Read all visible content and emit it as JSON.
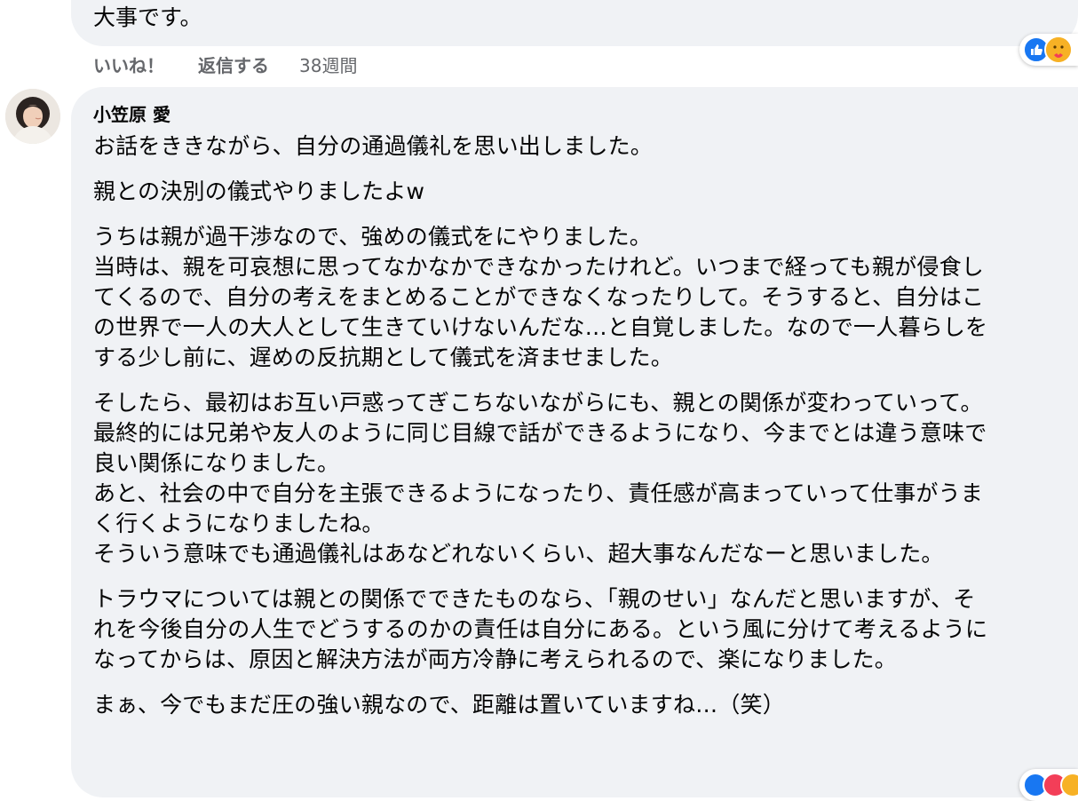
{
  "previous_comment": {
    "text_tail": "大事です。",
    "actions": {
      "like": "いいね！",
      "reply": "返信する",
      "time": "38週間"
    },
    "reactions": [
      "like-icon",
      "care-icon"
    ]
  },
  "comment": {
    "author": "小笠原 愛",
    "avatar": "profile-photo",
    "paragraphs": [
      [
        "お話をききながら、自分の通過儀礼を思い出しました。"
      ],
      [
        "親との決別の儀式やりましたよw"
      ],
      [
        "うちは親が過干渉なので、強めの儀式をにやりました。",
        "当時は、親を可哀想に思ってなかなかできなかったけれど。いつまで経っても親が侵食し",
        "てくるので、自分の考えをまとめることができなくなったりして。そうすると、自分はこ",
        "の世界で一人の大人として生きていけないんだな…と自覚しました。なので一人暮らしを",
        "する少し前に、遅めの反抗期として儀式を済ませました。"
      ],
      [
        "そしたら、最初はお互い戸惑ってぎこちないながらにも、親との関係が変わっていって。",
        "最終的には兄弟や友人のように同じ目線で話ができるようになり、今までとは違う意味で",
        "良い関係になりました。",
        "あと、社会の中で自分を主張できるようになったり、責任感が高まっていって仕事がうま",
        "く行くようになりましたね。",
        "そういう意味でも通過儀礼はあなどれないくらい、超大事なんだなーと思いました。"
      ],
      [
        "トラウマについては親との関係でできたものなら、「親のせい」なんだと思いますが、そ",
        "れを今後自分の人生でどうするのかの責任は自分にある。という風に分けて考えるように",
        "なってからは、原因と解決方法が両方冷静に考えられるので、楽になりました。"
      ],
      [
        "まぁ、今でもまだ圧の強い親なので、距離は置いていますね…（笑）"
      ]
    ],
    "reactions": [
      "like-icon",
      "love-icon",
      "care-icon"
    ]
  }
}
